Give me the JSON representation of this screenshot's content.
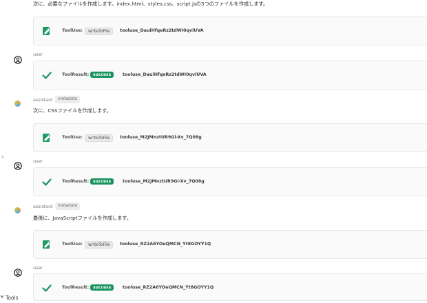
{
  "messages": {
    "m0_text": "次に、必要なファイルを作成します。index.html、styles.css、script.jsの3つのファイルを作成します。",
    "user_label": "user",
    "assistant_label": "assistant",
    "metadata_label": "metadata",
    "m2_text": "次に、CSSファイルを作成します。",
    "m4_text": "最後に、JavaScriptファイルを作成します。"
  },
  "tool_use": {
    "label": "ToolUse:",
    "chip": "writeToFile",
    "ids": [
      "tooluse_DauiHfqeRz2tdWI0qviUVA",
      "tooluse_M2JMnztUR9Gi-Xv_7Q08g",
      "tooluse_RZ2A6YOeQMCN_Yt8GOYY1Q"
    ]
  },
  "tool_result": {
    "label": "ToolResult:",
    "chip": "success",
    "ids": [
      "tooluse_DauiHfqeRz2tdWI0qviUVA",
      "tooluse_M2JMnztUR9Gi-Xv_7Q08g",
      "tooluse_RZ2A6YOeQMCN_Yt8GOYY1Q"
    ]
  },
  "sidebar": {
    "chevron": "›",
    "tools_label": "Tools"
  },
  "colors": {
    "success": "#17935c",
    "file_icon": "#1f9a62"
  }
}
